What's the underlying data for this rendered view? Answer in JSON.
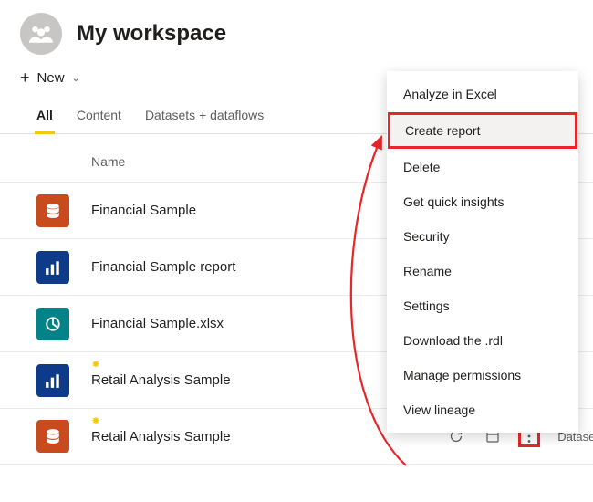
{
  "header": {
    "title": "My workspace"
  },
  "newButton": {
    "label": "New"
  },
  "tabs": [
    {
      "label": "All",
      "active": true
    },
    {
      "label": "Content",
      "active": false
    },
    {
      "label": "Datasets + dataflows",
      "active": false
    }
  ],
  "columns": {
    "name": "Name"
  },
  "items": [
    {
      "name": "Financial Sample",
      "iconKind": "dataset",
      "color": "orange"
    },
    {
      "name": "Financial Sample report",
      "iconKind": "report",
      "color": "blue"
    },
    {
      "name": "Financial Sample.xlsx",
      "iconKind": "workbook",
      "color": "teal"
    },
    {
      "name": "Retail Analysis Sample",
      "iconKind": "report",
      "color": "blue",
      "spark": true
    },
    {
      "name": "Retail Analysis Sample",
      "iconKind": "dataset",
      "color": "orange",
      "spark": true,
      "selected": true,
      "typeLabel": "Dataset"
    }
  ],
  "contextMenu": {
    "items": [
      "Analyze in Excel",
      "Create report",
      "Delete",
      "Get quick insights",
      "Security",
      "Rename",
      "Settings",
      "Download the .rdl",
      "Manage permissions",
      "View lineage"
    ],
    "highlightedIndex": 1
  },
  "annotation": {
    "arrowColor": "#e8262a",
    "highlightColor": "#e8262a"
  }
}
